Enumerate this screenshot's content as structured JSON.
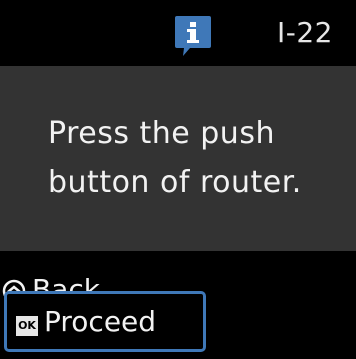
{
  "screen": {
    "status": {
      "icon": "info-icon",
      "code": "I-22"
    },
    "message": {
      "line1": "Press the push",
      "line2": "button of router."
    },
    "actions": {
      "back": {
        "icon": "back-button-icon",
        "label": "Back"
      },
      "proceed": {
        "badge": "OK",
        "label": "Proceed"
      }
    }
  },
  "colors": {
    "background": "#000000",
    "panel": "#333333",
    "accent": "#3f78b8",
    "text": "#f2f2f2"
  }
}
